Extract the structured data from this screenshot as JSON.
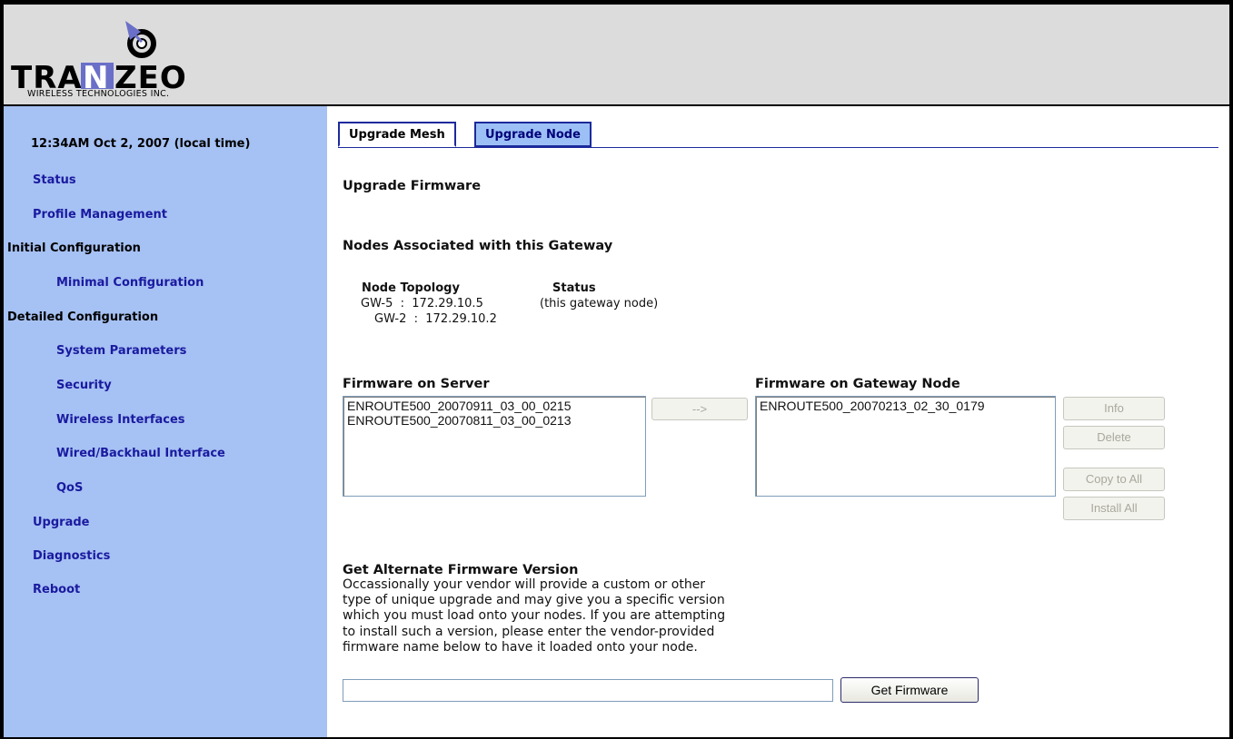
{
  "brand": {
    "name": "TRANZEO",
    "tagline": "WIRELESS TECHNOLOGIES INC.",
    "accent": "#6a6fc8"
  },
  "sidebar": {
    "clock": "12:34AM Oct 2, 2007 (local time)",
    "items": [
      {
        "label": "Status"
      },
      {
        "label": "Profile Management"
      },
      {
        "label": "Initial Configuration"
      },
      {
        "label": "Minimal Configuration"
      },
      {
        "label": "Detailed Configuration"
      },
      {
        "label": "System Parameters"
      },
      {
        "label": "Security"
      },
      {
        "label": "Wireless Interfaces"
      },
      {
        "label": "Wired/Backhaul Interface"
      },
      {
        "label": "QoS"
      },
      {
        "label": "Upgrade"
      },
      {
        "label": "Diagnostics"
      },
      {
        "label": "Reboot"
      }
    ]
  },
  "tabs": [
    {
      "label": "Upgrade Mesh",
      "active": true
    },
    {
      "label": "Upgrade Node",
      "active": false
    }
  ],
  "main": {
    "title": "Upgrade Firmware",
    "nodes_heading": "Nodes Associated with this Gateway",
    "topology": {
      "col_topology": "Node Topology",
      "col_status": "Status",
      "rows": [
        {
          "node": "GW-5  :  172.29.10.5",
          "status": "(this gateway node)"
        },
        {
          "node": "GW-2  :  172.29.10.2",
          "status": ""
        }
      ]
    },
    "server_heading": "Firmware on Server",
    "server_firmware": [
      "ENROUTE500_20070911_03_00_0215",
      "ENROUTE500_20070811_03_00_0213"
    ],
    "transfer_button": "-->",
    "gateway_heading": "Firmware on Gateway Node",
    "gateway_firmware": [
      "ENROUTE500_20070213_02_30_0179"
    ],
    "buttons": {
      "info": "Info",
      "delete": "Delete",
      "copy_all": "Copy to All",
      "install_all": "Install All"
    },
    "alt_heading": "Get Alternate Firmware Version",
    "alt_description": [
      "Occassionally your vendor will provide a custom or other",
      "type of unique upgrade and may give you a specific version",
      "which you must load onto your nodes. If you are attempting",
      "to install such a version, please enter the vendor-provided",
      "firmware name below to have it loaded onto your node."
    ],
    "alt_input_value": "",
    "get_firmware_button": "Get Firmware"
  }
}
